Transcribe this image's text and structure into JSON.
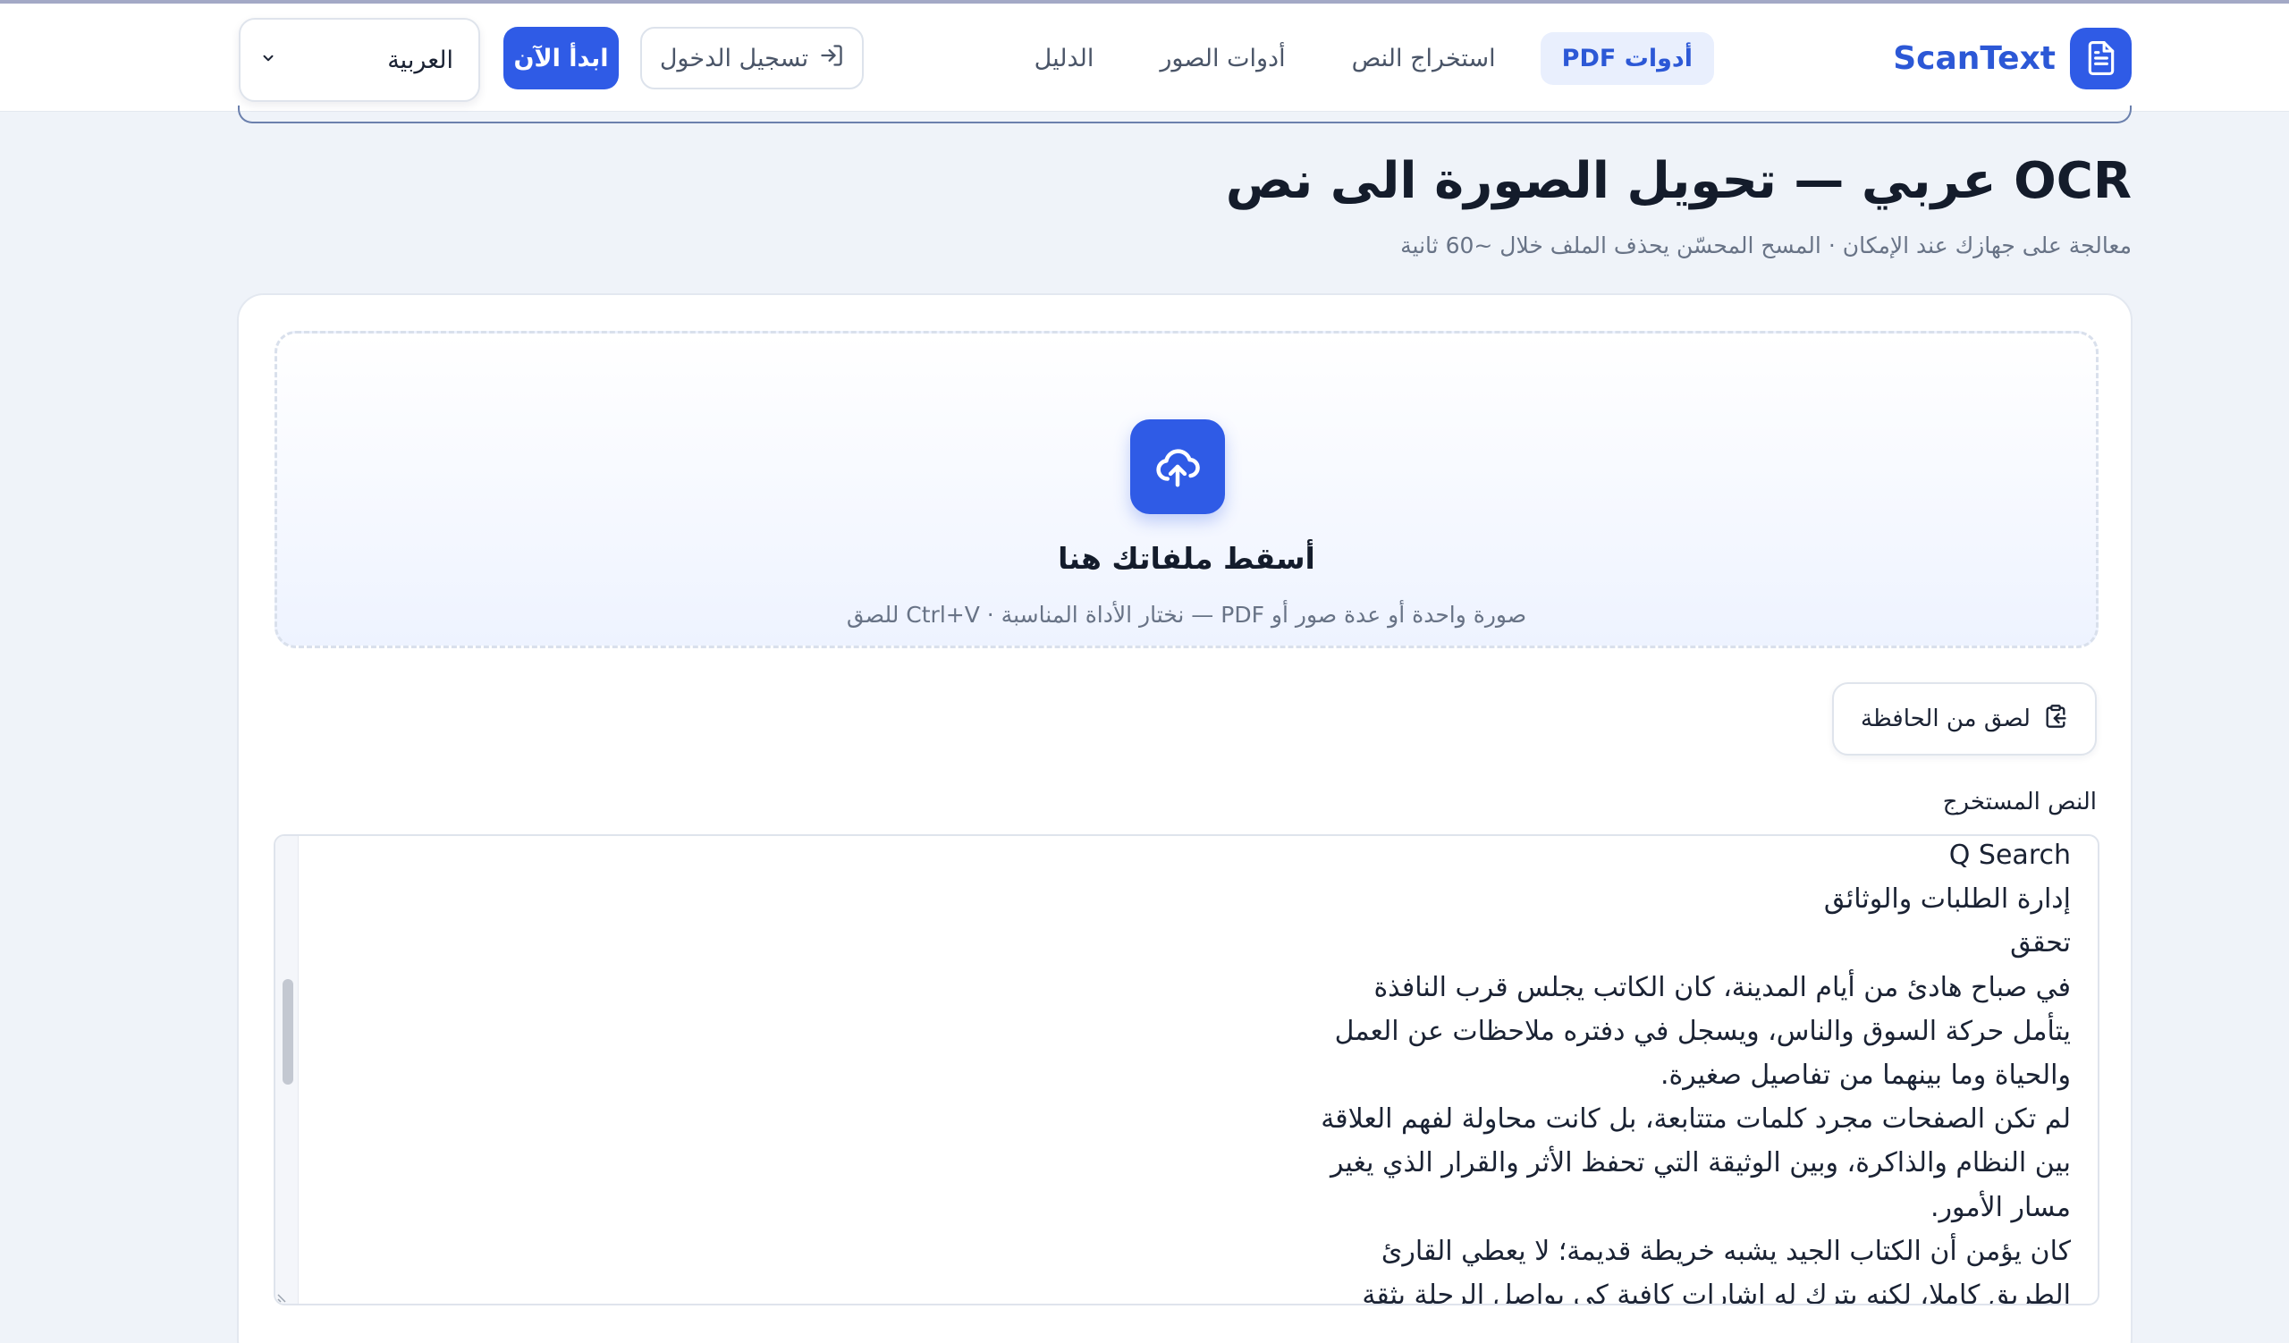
{
  "header": {
    "brand": {
      "name": "ScanText",
      "icon": "document-icon"
    },
    "nav": [
      {
        "label": "أدوات PDF",
        "active": true
      },
      {
        "label": "استخراج النص",
        "active": false
      },
      {
        "label": "أدوات الصور",
        "active": false
      },
      {
        "label": "الدليل",
        "active": false
      }
    ],
    "login_label": "تسجيل الدخول",
    "start_label": "ابدأ الآن",
    "language": {
      "selected": "العربية",
      "icon": "chevron-down-icon"
    }
  },
  "page": {
    "title": "OCR عربي — تحويل الصورة الى نص",
    "subtitle": "معالجة على جهازك عند الإمكان · المسح المحسّن يحذف الملف خلال ~60 ثانية"
  },
  "dropzone": {
    "icon": "cloud-upload-icon",
    "title": "أسقط ملفاتك هنا",
    "subtitle": "صورة واحدة أو عدة صور أو PDF — نختار الأداة المناسبة · Ctrl+V للصق"
  },
  "paste_button": {
    "label": "لصق من الحافظة",
    "icon": "clipboard-icon"
  },
  "output": {
    "label": "النص المستخرج",
    "lines": [
      "Q Search",
      "إدارة الطلبات والوثائق",
      "تحقق",
      "في صباح هادئ من أيام المدينة، كان الكاتب يجلس قرب النافذة",
      "يتأمل حركة السوق والناس، ويسجل في دفتره ملاحظات عن العمل",
      "والحياة وما بينهما من تفاصيل صغيرة.",
      "لم تكن الصفحات مجرد كلمات متتابعة، بل كانت محاولة لفهم العلاقة",
      "بين النظام والذاكرة، وبين الوثيقة التي تحفظ الأثر والقرار الذي يغير",
      "مسار الأمور.",
      "كان يؤمن أن الكتاب الجيد يشبه خريطة قديمة؛ لا يعطي القارئ",
      "الطريق كاملا، لكنه يترك له اشارات كافية كي يواصل الرحلة بثقة"
    ]
  },
  "colors": {
    "accent": "#2f5be6",
    "background": "#eff3f9",
    "active_nav_bg": "#e9effd"
  }
}
